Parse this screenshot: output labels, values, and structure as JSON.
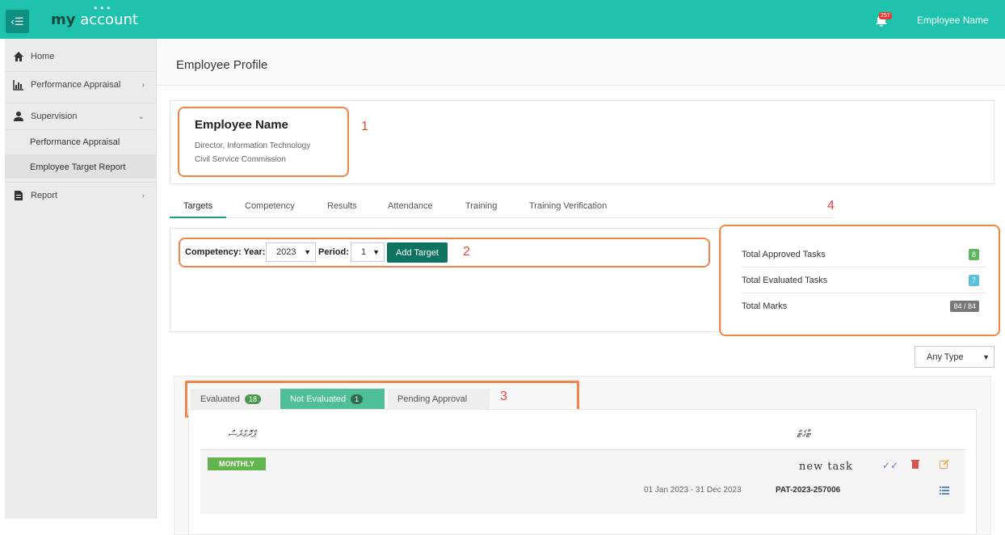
{
  "app": {
    "title_prefix": "my",
    "title_suffix": "account",
    "user_name": "Employee Name",
    "notification_count": "257"
  },
  "sidebar": {
    "items": [
      {
        "label": "Home",
        "icon": "home-icon"
      },
      {
        "label": "Performance Appraisal",
        "icon": "chart-icon"
      },
      {
        "label": "Supervision",
        "icon": "users-icon"
      },
      {
        "label": "Report",
        "icon": "file-icon"
      }
    ],
    "sub_items": [
      "Performance Appraisal",
      "Employee Target Report"
    ]
  },
  "page": {
    "title": "Employee Profile"
  },
  "profile": {
    "name": "Employee Name",
    "position": "Director, Information Technology",
    "organization": "Civil Service Commission"
  },
  "annotations": [
    "1",
    "2",
    "3",
    "4"
  ],
  "tabs": [
    "Targets",
    "Competency",
    "Results",
    "Attendance",
    "Training",
    "Training Verification"
  ],
  "target_form": {
    "label_year": "Competency: Year:",
    "year": "2023",
    "label_period": "Period:",
    "period": "1",
    "add_button": "Add Target"
  },
  "stats": [
    {
      "label": "Total Approved Tasks",
      "value": "8",
      "color": "#5cb85c"
    },
    {
      "label": "Total Evaluated Tasks",
      "value": "7",
      "color": "#5bc0de"
    },
    {
      "label": "Total Marks",
      "value": "84 / 84",
      "color": "#777777"
    }
  ],
  "filter": {
    "type": "Any Type"
  },
  "evaluation_tabs": [
    {
      "label": "Evaluated",
      "count": "18"
    },
    {
      "label": "Not Evaluated",
      "count": "1"
    },
    {
      "label": "Pending Approval"
    }
  ],
  "task_table": {
    "headers": [
      "ޕްރޮގްރެސް",
      "ޓާގެޓް"
    ],
    "task": {
      "frequency": "MONTHLY",
      "name": "new task",
      "date_range": "01 Jan 2023 - 31 Dec 2023",
      "id": "PAT-2023-257006"
    }
  },
  "colors": {
    "accent": "#1fc3ad",
    "dark_accent": "#0d7360",
    "highlight": "#f0844a",
    "annotation": "#e8433a"
  }
}
